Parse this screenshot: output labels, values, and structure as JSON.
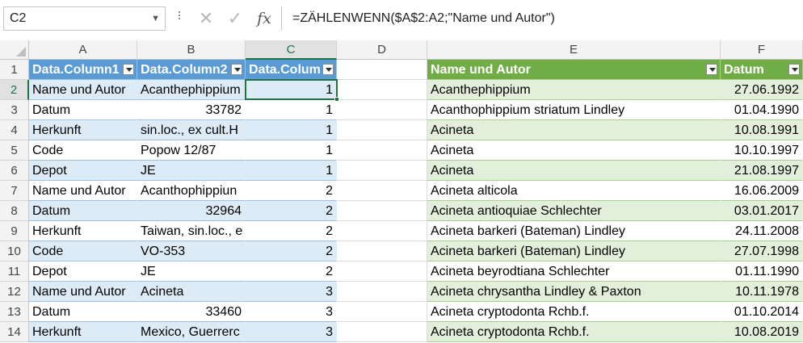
{
  "formula_bar": {
    "name_box": "C2",
    "formula": "=ZÄHLENWENN($A$2:A2;\"Name und Autor\")",
    "cancel_glyph": "✕",
    "enter_glyph": "✓",
    "fx_glyph": "fx"
  },
  "columns": [
    "A",
    "B",
    "C",
    "D",
    "E",
    "F"
  ],
  "selected_column": "C",
  "rows": [
    "1",
    "2",
    "3",
    "4",
    "5",
    "6",
    "7",
    "8",
    "9",
    "10",
    "11",
    "12",
    "13",
    "14"
  ],
  "selected_row": "2",
  "table1": {
    "headers": [
      "Data.Column1",
      "Data.Column2",
      "Data.Colum"
    ],
    "rows": [
      [
        "Name und Autor",
        "Acanthephippium",
        "1"
      ],
      [
        "Datum",
        "33782",
        "1"
      ],
      [
        "Herkunft",
        "sin.loc., ex cult.H",
        "1"
      ],
      [
        "Code",
        "Popow 12/87",
        "1"
      ],
      [
        "Depot",
        "JE",
        "1"
      ],
      [
        "Name und Autor",
        "Acanthophippiun",
        "2"
      ],
      [
        "Datum",
        "32964",
        "2"
      ],
      [
        "Herkunft",
        "Taiwan, sin.loc., e",
        "2"
      ],
      [
        "Code",
        "VO-353",
        "2"
      ],
      [
        "Depot",
        "JE",
        "2"
      ],
      [
        "Name und Autor",
        "Acineta",
        "3"
      ],
      [
        "Datum",
        "33460",
        "3"
      ],
      [
        "Herkunft",
        "Mexico, Guerrerc",
        "3"
      ]
    ]
  },
  "table2": {
    "headers": [
      "Name und Autor",
      "Datum"
    ],
    "rows": [
      [
        "Acanthephippium",
        "27.06.1992"
      ],
      [
        "Acanthophippium striatum Lindley",
        "01.04.1990"
      ],
      [
        "Acineta",
        "10.08.1991"
      ],
      [
        "Acineta",
        "10.10.1997"
      ],
      [
        "Acineta",
        "21.08.1997"
      ],
      [
        "Acineta alticola",
        "16.06.2009"
      ],
      [
        "Acineta antioquiae Schlechter",
        "03.01.2017"
      ],
      [
        "Acineta barkeri (Bateman) Lindley",
        "24.11.2008"
      ],
      [
        "Acineta barkeri (Bateman) Lindley",
        "27.07.1998"
      ],
      [
        "Acineta beyrodtiana Schlechter",
        "01.11.1990"
      ],
      [
        "Acineta chrysantha Lindley & Paxton",
        "10.11.1978"
      ],
      [
        "Acineta cryptodonta Rchb.f.",
        "01.10.2014"
      ],
      [
        "Acineta cryptodonta Rchb.f.",
        "10.08.2019"
      ]
    ]
  },
  "colors": {
    "table1_header": "#5b9bd5",
    "table1_band": "#ddebf7",
    "table2_header": "#70ad47",
    "table2_band": "#e2efda",
    "selection": "#217346"
  }
}
